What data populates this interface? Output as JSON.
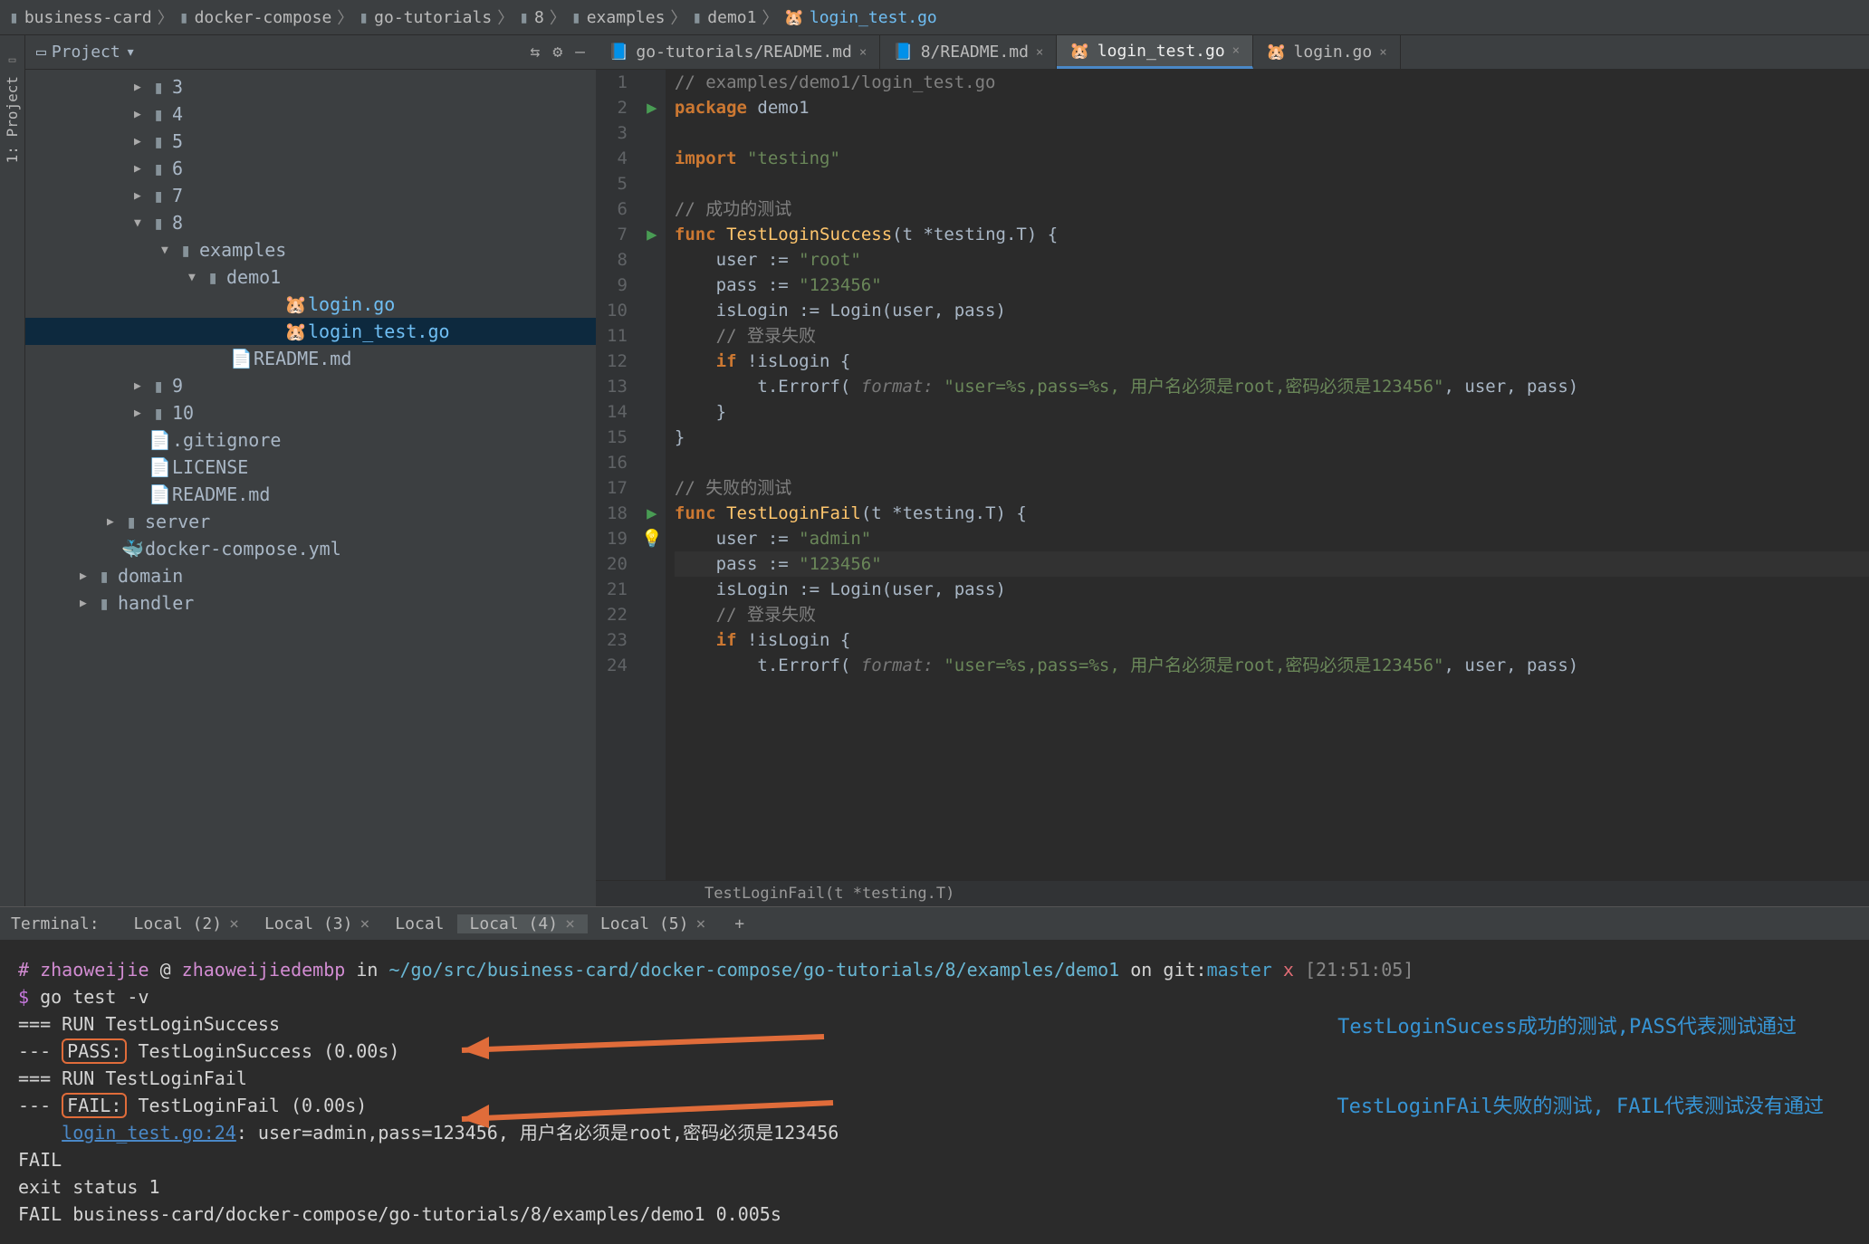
{
  "breadcrumbs": [
    "business-card",
    "docker-compose",
    "go-tutorials",
    "8",
    "examples",
    "demo1",
    "login_test.go"
  ],
  "project": {
    "title": "Project",
    "tree": [
      {
        "indent": 0,
        "arrow": "▶",
        "type": "folder",
        "label": "3"
      },
      {
        "indent": 0,
        "arrow": "▶",
        "type": "folder",
        "label": "4"
      },
      {
        "indent": 0,
        "arrow": "▶",
        "type": "folder",
        "label": "5"
      },
      {
        "indent": 0,
        "arrow": "▶",
        "type": "folder",
        "label": "6"
      },
      {
        "indent": 0,
        "arrow": "▶",
        "type": "folder",
        "label": "7"
      },
      {
        "indent": 0,
        "arrow": "▼",
        "type": "folder",
        "label": "8"
      },
      {
        "indent": 1,
        "arrow": "▼",
        "type": "folder",
        "label": "examples"
      },
      {
        "indent": 2,
        "arrow": "▼",
        "type": "folder",
        "label": "demo1"
      },
      {
        "indent": 4,
        "arrow": "",
        "type": "gofile",
        "label": "login.go",
        "active": true
      },
      {
        "indent": 4,
        "arrow": "",
        "type": "gofile",
        "label": "login_test.go",
        "active": true,
        "selected": true
      },
      {
        "indent": 3,
        "arrow": "",
        "type": "mdfile",
        "label": "README.md"
      },
      {
        "indent": 0,
        "arrow": "▶",
        "type": "folder",
        "label": "9"
      },
      {
        "indent": 0,
        "arrow": "▶",
        "type": "folder",
        "label": "10"
      },
      {
        "indent": 0,
        "arrow": "",
        "type": "file",
        "label": ".gitignore"
      },
      {
        "indent": 0,
        "arrow": "",
        "type": "file",
        "label": "LICENSE"
      },
      {
        "indent": 0,
        "arrow": "",
        "type": "mdfile",
        "label": "README.md"
      },
      {
        "indent": -1,
        "arrow": "▶",
        "type": "folder",
        "label": "server"
      },
      {
        "indent": -1,
        "arrow": "",
        "type": "dcfile",
        "label": "docker-compose.yml"
      },
      {
        "indent": -2,
        "arrow": "▶",
        "type": "folder",
        "label": "domain"
      },
      {
        "indent": -2,
        "arrow": "▶",
        "type": "folder",
        "label": "handler"
      }
    ]
  },
  "editorTabs": [
    {
      "icon": "md",
      "label": "go-tutorials/README.md",
      "active": false
    },
    {
      "icon": "md",
      "label": "8/README.md",
      "active": false
    },
    {
      "icon": "go",
      "label": "login_test.go",
      "active": true
    },
    {
      "icon": "go",
      "label": "login.go",
      "active": false
    }
  ],
  "code": {
    "lines": [
      {
        "n": 1,
        "html": "<span class='cmt'>// examples/demo1/login_test.go</span>"
      },
      {
        "n": 2,
        "html": "<span class='kw'>package</span> <span class='ident'>demo1</span>",
        "run": true
      },
      {
        "n": 3,
        "html": ""
      },
      {
        "n": 4,
        "html": "<span class='kw'>import</span> <span class='str'>\"testing\"</span>"
      },
      {
        "n": 5,
        "html": ""
      },
      {
        "n": 6,
        "html": "<span class='cmt'>// 成功的测试</span>"
      },
      {
        "n": 7,
        "html": "<span class='kw'>func</span> <span class='fn'>TestLoginSuccess</span>(t *testing.T) {",
        "run": true
      },
      {
        "n": 8,
        "html": "    user := <span class='str'>\"root\"</span>"
      },
      {
        "n": 9,
        "html": "    pass := <span class='str'>\"123456\"</span>"
      },
      {
        "n": 10,
        "html": "    isLogin := Login(user, pass)"
      },
      {
        "n": 11,
        "html": "    <span class='cmt'>// 登录失败</span>"
      },
      {
        "n": 12,
        "html": "    <span class='kw'>if</span> !isLogin {"
      },
      {
        "n": 13,
        "html": "        t.Errorf( <span class='param-hint'>format:</span> <span class='str'>\"user=%s,pass=%s, 用户名必须是root,密码必须是123456\"</span>, user, pass)"
      },
      {
        "n": 14,
        "html": "    }"
      },
      {
        "n": 15,
        "html": "}"
      },
      {
        "n": 16,
        "html": ""
      },
      {
        "n": 17,
        "html": "<span class='cmt'>// 失败的测试</span>"
      },
      {
        "n": 18,
        "html": "<span class='kw'>func</span> <span class='fn'>TestLoginFail</span>(t *testing.T) {",
        "run": true
      },
      {
        "n": 19,
        "html": "    user := <span class='str'>\"admin\"</span>",
        "bulb": true
      },
      {
        "n": 20,
        "html": "    pass := <span class='str'>\"123456\"</span>",
        "hl": true
      },
      {
        "n": 21,
        "html": "    isLogin := Login(user, pass)"
      },
      {
        "n": 22,
        "html": "    <span class='cmt'>// 登录失败</span>"
      },
      {
        "n": 23,
        "html": "    <span class='kw'>if</span> !isLogin {"
      },
      {
        "n": 24,
        "html": "        t.Errorf( <span class='param-hint'>format:</span> <span class='str'>\"user=%s,pass=%s, 用户名必须是root,密码必须是123456\"</span>, user, pass)"
      }
    ],
    "breadcrumb": "TestLoginFail(t *testing.T)"
  },
  "terminal": {
    "title": "Terminal:",
    "tabs": [
      {
        "label": "Local (2)",
        "close": true
      },
      {
        "label": "Local (3)",
        "close": true
      },
      {
        "label": "Local",
        "close": false
      },
      {
        "label": "Local (4)",
        "close": true,
        "active": true
      },
      {
        "label": "Local (5)",
        "close": true
      }
    ],
    "user": "zhaoweijie",
    "host": "zhaoweijiedembp",
    "path": "~/go/src/business-card/docker-compose/go-tutorials/8/examples/demo1",
    "branch": "master",
    "time": "[21:51:05]",
    "cmd": "go test -v",
    "output": {
      "run1": "=== RUN   TestLoginSuccess",
      "pass": "PASS:",
      "passLine": "TestLoginSuccess (0.00s)",
      "run2": "=== RUN   TestLoginFail",
      "fail": "FAIL:",
      "failLine": "TestLoginFail (0.00s)",
      "link": "login_test.go:24",
      "linkRest": ": user=admin,pass=123456, 用户名必须是root,密码必须是123456",
      "f1": "FAIL",
      "exit": "exit status 1",
      "f2": "FAIL    business-card/docker-compose/go-tutorials/8/examples/demo1      0.005s"
    },
    "annotations": {
      "a1": "TestLoginSucess成功的测试,PASS代表测试通过",
      "a2": "TestLoginFAil失败的测试, FAIL代表测试没有通过"
    }
  },
  "leftTab": "1: Project"
}
